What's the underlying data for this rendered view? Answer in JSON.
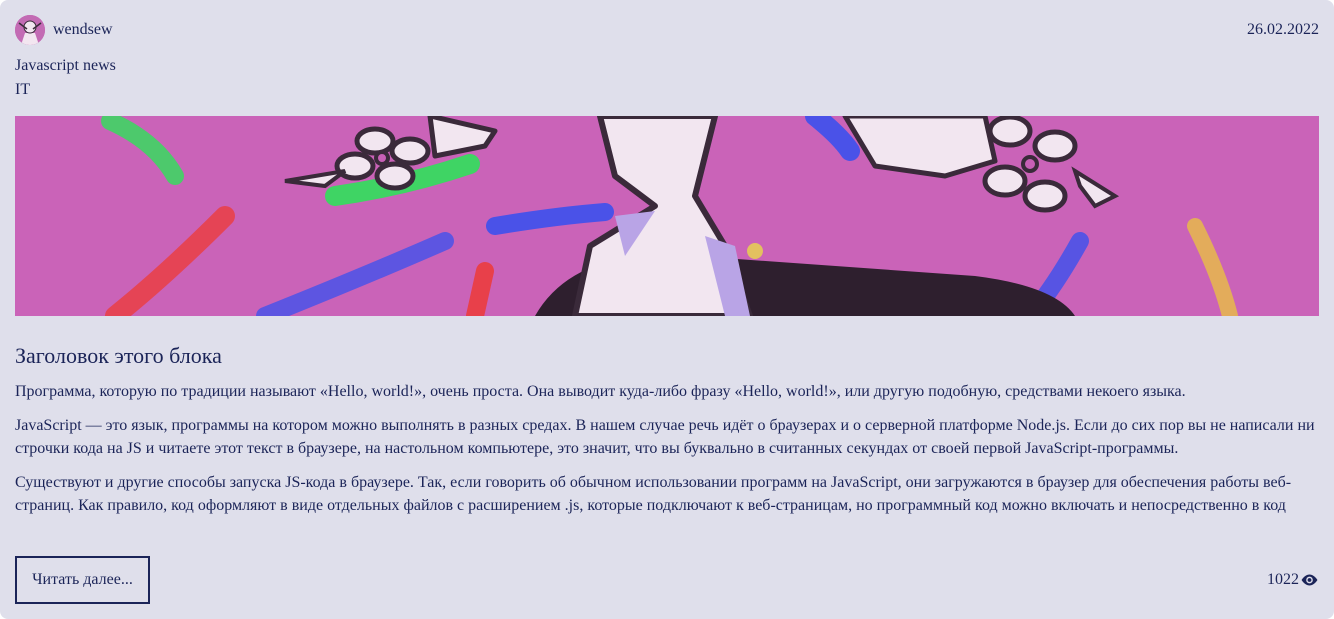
{
  "post": {
    "author": "wendsew",
    "date": "26.02.2022",
    "title_line": "Javascript news",
    "category": "IT",
    "heading": "Заголовок этого блока",
    "paragraphs": [
      "Программа, которую по традиции называют «Hello, world!», очень проста. Она выводит куда-либо фразу «Hello, world!», или другую подобную, средствами некоего языка.",
      "JavaScript — это язык, программы на котором можно выполнять в разных средах. В нашем случае речь идёт о браузерах и о серверной платформе Node.js. Если до сих пор вы не написали ни строчки кода на JS и читаете этот текст в браузере, на настольном компьютере, это значит, что вы буквально в считанных секундах от своей первой JavaScript-программы.",
      "Существуют и другие способы запуска JS-кода в браузере. Так, если говорить об обычном использовании программ на JavaScript, они загружаются в браузер для обеспечения работы веб-страниц. Как правило, код оформляют в виде отдельных файлов с расширением .js, которые подключают к веб-страницам, но программный код можно включать и непосредственно в код страницы."
    ],
    "read_more_label": "Читать далее...",
    "views": "1022"
  },
  "icons": {
    "views": "eye-icon",
    "avatar": "user-avatar-image"
  },
  "colors": {
    "card_bg": "#dfdfeb",
    "text": "#1b2458",
    "banner_bg": "#c760b6"
  }
}
